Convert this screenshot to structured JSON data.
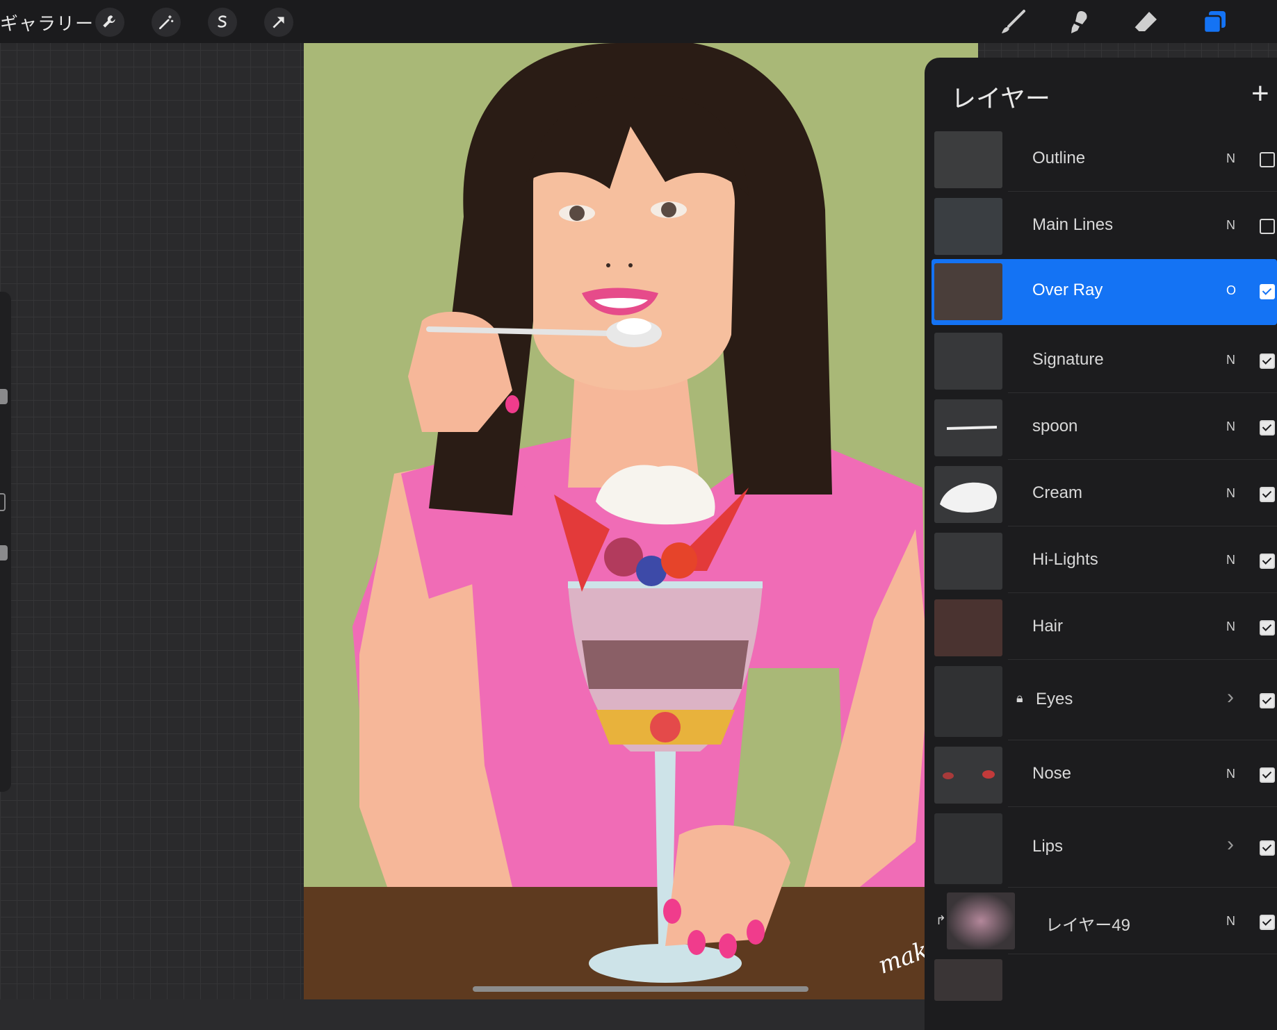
{
  "topbar": {
    "gallery_label": "ギャラリー",
    "left_tools": [
      "wrench-icon",
      "magic-wand-icon",
      "selection-icon",
      "transform-arrow-icon"
    ],
    "right_tools": [
      "brush-icon",
      "smudge-icon",
      "eraser-icon",
      "layers-icon"
    ],
    "accent": "#1473f4"
  },
  "layers_panel": {
    "title": "レイヤー",
    "add_label": "+",
    "layers": [
      {
        "name": "Outline",
        "mode": "N",
        "visible": false,
        "selected": false
      },
      {
        "name": "Main Lines",
        "mode": "N",
        "visible": false,
        "selected": false
      },
      {
        "name": "Over Ray",
        "mode": "O",
        "visible": true,
        "selected": true
      },
      {
        "name": "Signature",
        "mode": "N",
        "visible": true,
        "selected": false
      },
      {
        "name": "spoon",
        "mode": "N",
        "visible": true,
        "selected": false
      },
      {
        "name": "Cream",
        "mode": "N",
        "visible": true,
        "selected": false
      },
      {
        "name": "Hi-Lights",
        "mode": "N",
        "visible": true,
        "selected": false
      },
      {
        "name": "Hair",
        "mode": "N",
        "visible": true,
        "selected": false
      },
      {
        "name": "Eyes",
        "mode": "group",
        "visible": true,
        "selected": false,
        "locked": true
      },
      {
        "name": "Nose",
        "mode": "N",
        "visible": true,
        "selected": false
      },
      {
        "name": "Lips",
        "mode": "group",
        "visible": true,
        "selected": false
      },
      {
        "name": "レイヤー49",
        "mode": "N",
        "visible": true,
        "selected": false,
        "clipped": true
      }
    ]
  },
  "canvas": {
    "signature_text": "mak"
  }
}
